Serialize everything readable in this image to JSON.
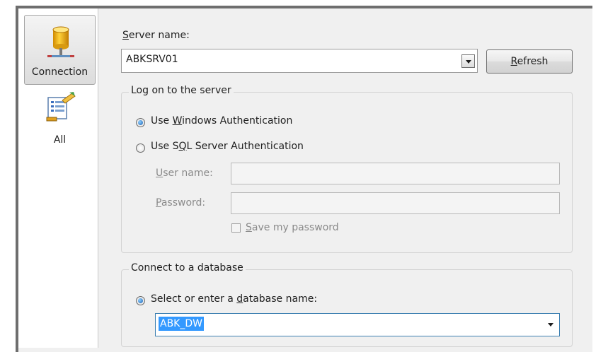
{
  "nav": {
    "items": [
      {
        "label": "Connection",
        "icon": "database-server-icon",
        "selected": true
      },
      {
        "label": "All",
        "icon": "properties-list-icon",
        "selected": false
      }
    ]
  },
  "server": {
    "label_pre": "",
    "label_ul": "S",
    "label_post": "erver name:",
    "value": "ABKSRV01",
    "refresh_ul": "R",
    "refresh_post": "efresh"
  },
  "logon": {
    "title": "Log on to the server",
    "windows_auth": {
      "pre": "Use ",
      "ul": "W",
      "post": "indows Authentication",
      "selected": true
    },
    "sql_auth": {
      "pre": "Use S",
      "ul": "Q",
      "post": "L Server Authentication",
      "selected": false
    },
    "username": {
      "ul": "U",
      "post": "ser name:",
      "value": ""
    },
    "password": {
      "ul": "P",
      "post": "assword:",
      "value": ""
    },
    "save_password": {
      "ul": "S",
      "post": "ave my password",
      "checked": false
    }
  },
  "database": {
    "title": "Connect to a database",
    "select_option": {
      "pre": "Select or enter a ",
      "ul": "d",
      "post": "atabase name:",
      "selected": true
    },
    "value": "ABK_DW"
  },
  "colors": {
    "accent": "#3399ff",
    "panel": "#f0f0f0"
  }
}
